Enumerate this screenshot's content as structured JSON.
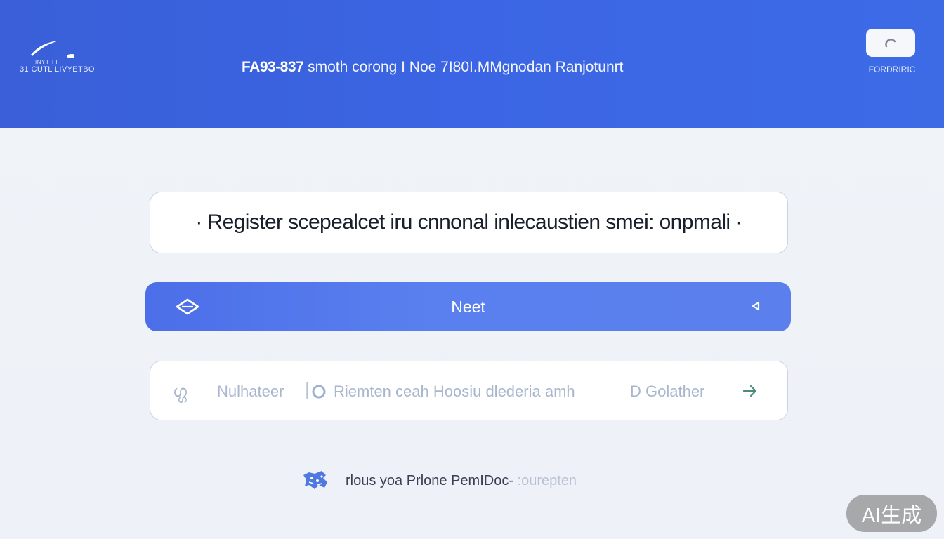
{
  "header": {
    "logo_small_text": "INYT TT",
    "logo_text": "31 CUTL LIVYETBO",
    "title_strong": "FA93-837",
    "title_rest": "smoth corong I Noe 7I80I.MMgnodan Ranjotunrt",
    "corner_label": "FORDRIRIC",
    "icons": {
      "logo": "swoosh-logo",
      "corner": "refresh-icon"
    }
  },
  "main": {
    "info_text": "· Register scepealcet iru cnnonal inlecaustien smei: onpmali ·",
    "primary_button": {
      "label": "Neet",
      "left_icon": "diamond-arrow-icon",
      "right_icon": "triangle-left-icon"
    },
    "secondary": {
      "code": "ഗ്ഗ",
      "label1": "Nulhateer",
      "label2": "Riemten ceah Hoosiu dlederia amh",
      "label3": "D Golather",
      "icons": {
        "circle": "circle-icon",
        "arrow": "arrow-right-icon"
      }
    },
    "footer": {
      "text": "rlous yoa Prlone PemIDoc-",
      "faded_text": ":ourepten",
      "icon": "leopard-icon"
    }
  },
  "watermark": {
    "text": "AI生成"
  },
  "colors": {
    "header_bg": "#3b65e4",
    "primary": "#5a80ef",
    "border": "#c9d3e6",
    "background": "#eef2f8"
  }
}
